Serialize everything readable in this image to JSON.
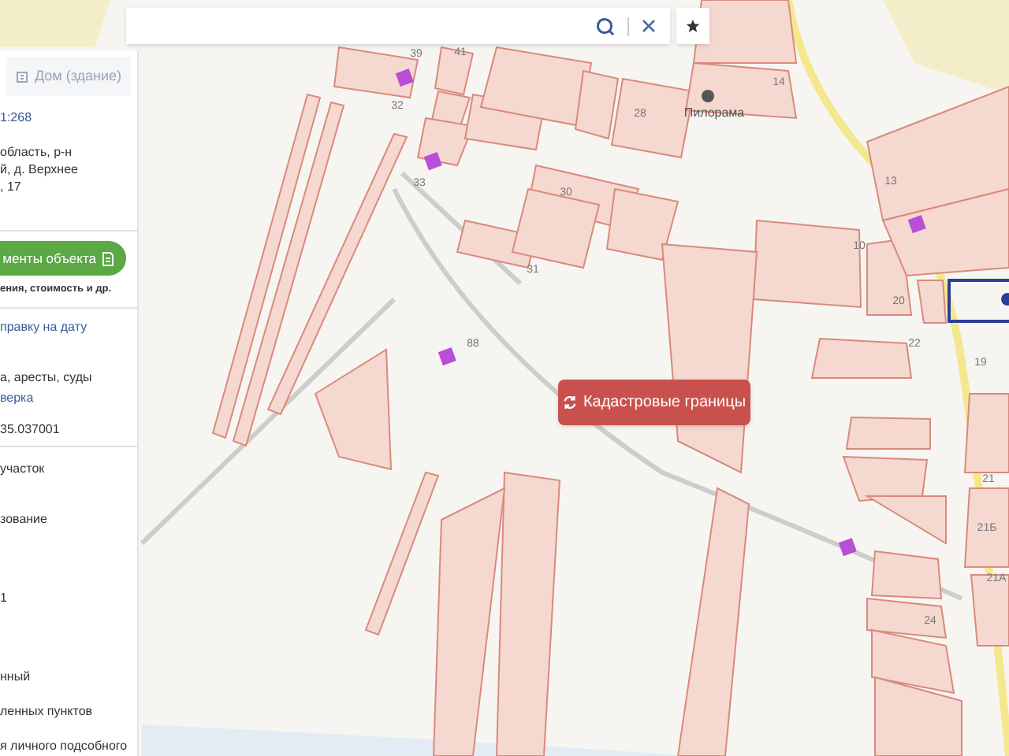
{
  "panel": {
    "tab": "Дом (здание)",
    "number": "1:268",
    "address": [
      "область, р-н",
      "й, д. Верхнее",
      ", 17"
    ],
    "documents_button": "менты объекта",
    "documents_note": "ения, стоимость и др.",
    "link_date": "правку на дату",
    "restrictions": "а, аресты, суды",
    "link_check": "верка",
    "code": "35.037001",
    "fields": [
      "участок",
      "зование",
      "1",
      "нный",
      "ленных пунктов",
      "я личного подсобного"
    ]
  },
  "map": {
    "labels": [
      "39",
      "41",
      "32",
      "33",
      "30",
      "31",
      "28",
      "14",
      "88",
      "10",
      "20",
      "22",
      "13",
      "19",
      "21",
      "21Б",
      "21А",
      "24"
    ],
    "poi": "Пилорама",
    "layer_button": "Кадастровые границы"
  }
}
